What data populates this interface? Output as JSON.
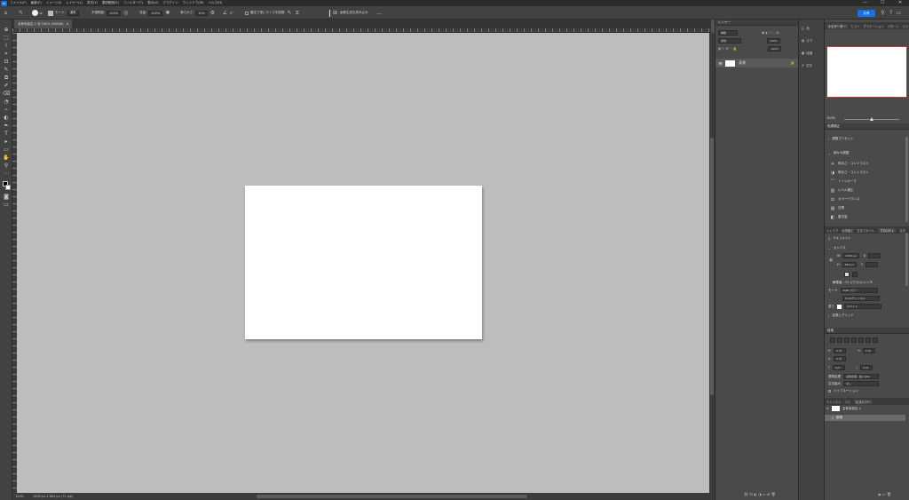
{
  "app": {
    "logo": "Ps"
  },
  "menu": [
    "ファイル(F)",
    "編集(E)",
    "イメージ(I)",
    "レイヤー(L)",
    "書式(Y)",
    "選択範囲(S)",
    "フィルター(T)",
    "表示(V)",
    "プラグイン",
    "ウィンドウ(W)",
    "ヘルプ(H)"
  ],
  "window_controls": {
    "minimize": "—",
    "maximize": "☐",
    "close": "✕"
  },
  "options": {
    "home_icon": "⌂",
    "brush_icon": "✎",
    "brush_size": "30",
    "mode_label": "モード:",
    "mode_value": "通常",
    "opacity_label": "不透明度:",
    "opacity_value": "100%",
    "flow_label": "流量:",
    "flow_value": "100%",
    "smoothing_label": "滑らかさ:",
    "smoothing_value": "10%",
    "angle_value": "0°",
    "checkbox_label": "筆圧で常にサイズを制御",
    "task_label": "画像生成を読み込み",
    "more": "…",
    "share_label": "共有"
  },
  "tools": [
    "⌂",
    "⊕",
    "⬚",
    "⌇",
    "⌖",
    "⊡",
    "✎",
    "⧉",
    "✐",
    "⌫",
    "◔",
    "⌁",
    "◐",
    "✒",
    "T",
    "▸",
    "▭",
    "✋",
    "⚲",
    "⋯"
  ],
  "document": {
    "tab": "名称未設定-1 @ 100% (RGB/8)",
    "status_zoom": "100%",
    "status_size": "1000 px x 664 px (72 ppi)"
  },
  "layers": {
    "title": "レイヤー",
    "search_placeholder": "種類",
    "blend": "通常",
    "opacity": "100%",
    "fill": "100%",
    "layer_name": "背景",
    "lock_icon": "🔒"
  },
  "iconstrip": [
    {
      "icon": "◱",
      "label": "色"
    },
    {
      "icon": "▤",
      "label": "スウ"
    },
    {
      "icon": "▦",
      "label": "段落"
    },
    {
      "icon": "✢",
      "label": "文字"
    }
  ],
  "navigator": {
    "tabs": [
      "ナビゲーター",
      "ヒスト",
      "グラデーション",
      "パターン",
      "パス"
    ],
    "zoom": "100%"
  },
  "adjustments": {
    "title": "色調補正",
    "presets": "調整プリセット",
    "single": "個々の調整",
    "items": [
      {
        "icon": "☀",
        "label": "明るさ・コントラスト"
      },
      {
        "icon": "◑",
        "label": "明るさ・コントラスト"
      },
      {
        "icon": "⌒",
        "label": "トーンカーブ"
      },
      {
        "icon": "▥",
        "label": "レベル補正"
      },
      {
        "icon": "⚖",
        "label": "カラーバランス"
      },
      {
        "icon": "▨",
        "label": "白黒"
      },
      {
        "icon": "◧",
        "label": "露光量"
      }
    ]
  },
  "properties": {
    "tabs": [
      "シェイプ",
      "色調補正",
      "文字スタイル",
      "プロパティ",
      "文字"
    ],
    "section": "ドキュメント",
    "canvas_title": "カンバス",
    "w_label": "W",
    "w_value": "1000 px",
    "h_label": "H",
    "h_value": "664 px",
    "x_label": "X",
    "y_label": "Y",
    "resolution": "解像度 : 72 ピクセル/インチ",
    "mode_label": "モード",
    "mode_value": "RGB カラー",
    "bit_value": "8 bit/チャンネル",
    "fill_label": "塗り",
    "fill_value": "ホワイト",
    "guides_label": "定規とグリッド"
  },
  "paragraph": {
    "title": "段落",
    "indent_left": "0 pt",
    "indent_right": "0 pt",
    "indent_first": "0 pt",
    "space_before": "0 pt",
    "space_after": "0 pt",
    "kinsoku_label": "禁則処理",
    "kinsoku_value": "禁則処理 : 強い(JIS)",
    "mojikumi_label": "文字組み",
    "mojikumi_value": "なし",
    "hyphenate": "ハイフネーション"
  },
  "history": {
    "tabs": [
      "チャンネル",
      "パス",
      "ヒストリー"
    ],
    "snapshot": "名称未設定-1",
    "item": "新規"
  }
}
